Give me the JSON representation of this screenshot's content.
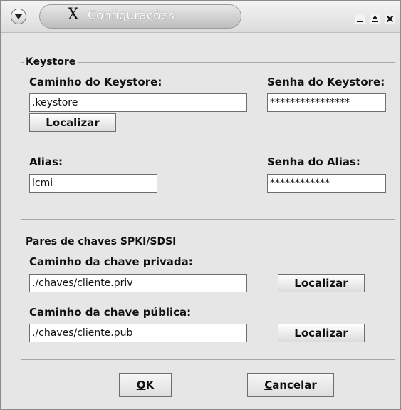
{
  "window": {
    "title": "Configurações",
    "title_icon": "X"
  },
  "keystore": {
    "legend": "Keystore",
    "path_label": "Caminho do Keystore:",
    "path_value": ".keystore",
    "password_label": "Senha do Keystore:",
    "password_value": "****************",
    "locate_label": "Localizar",
    "alias_label": "Alias:",
    "alias_value": "lcmi",
    "alias_password_label": "Senha do Alias:",
    "alias_password_value": "************"
  },
  "spki": {
    "legend": "Pares de chaves SPKI/SDSI",
    "private_label": "Caminho da chave privada:",
    "private_value": "./chaves/cliente.priv",
    "private_locate": "Localizar",
    "public_label": "Caminho da chave pública:",
    "public_value": "./chaves/cliente.pub",
    "public_locate": "Localizar"
  },
  "footer": {
    "ok_first": "O",
    "ok_rest": "K",
    "cancel_first": "C",
    "cancel_rest": "ancelar"
  },
  "icons": {
    "menu": "chevron-down-icon",
    "minimize": "minimize-icon",
    "maximize": "maximize-icon",
    "close": "close-icon"
  }
}
